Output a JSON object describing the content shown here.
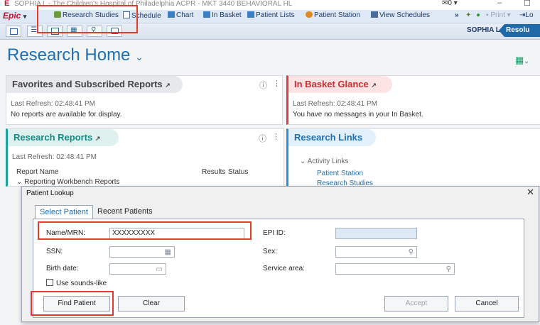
{
  "window": {
    "title": "SOPHIA L - The Children's Hospital of Philadelphia ACPR - MKT 3440 BEHAVIORAL HL",
    "mail_count": "0"
  },
  "toolbar": {
    "epic_label": "Epic",
    "items": [
      "Research Studies",
      "Schedule",
      "Chart",
      "In Basket",
      "Patient Lists",
      "Patient Station",
      "View Schedules"
    ],
    "print_label": "Print",
    "log_label": "Lo"
  },
  "header": {
    "user": "SOPHIA L.",
    "context": "Resolu"
  },
  "page": {
    "title": "Research Home"
  },
  "panels": {
    "favorites": {
      "title": "Favorites and Subscribed Reports",
      "last_refresh": "Last Refresh: 02:48:41 PM",
      "message": "No reports are available for display."
    },
    "inbasket": {
      "title": "In Basket Glance",
      "last_refresh": "Last Refresh: 02:48:41 PM",
      "message": "You have no messages in your In Basket."
    },
    "research_reports": {
      "title": "Research Reports",
      "last_refresh": "Last Refresh: 02:48:41 PM",
      "col_report": "Report Name",
      "col_results": "Results",
      "col_status": "Status",
      "group": "Reporting Workbench Reports"
    },
    "research_links": {
      "title": "Research Links",
      "section": "Activity Links",
      "links": [
        "Patient Station",
        "Research Studies"
      ]
    }
  },
  "dialog": {
    "title": "Patient Lookup",
    "tabs": [
      "Select Patient",
      "Recent Patients"
    ],
    "fields": {
      "name_mrn_label": "Name/MRN:",
      "name_mrn_value": "XXXXXXXXX",
      "epi_label": "EPI ID:",
      "ssn_label": "SSN:",
      "sex_label": "Sex:",
      "birth_label": "Birth date:",
      "service_label": "Service area:",
      "sounds_like_label": "Use sounds-like"
    },
    "buttons": {
      "find": "Find Patient",
      "clear": "Clear",
      "accept": "Accept",
      "cancel": "Cancel"
    }
  },
  "colors": {
    "accent": "#1f6fb2",
    "inbasket_red": "#e0383e",
    "reports_teal": "#1aa39a",
    "highlight_red": "#e23b2e"
  }
}
